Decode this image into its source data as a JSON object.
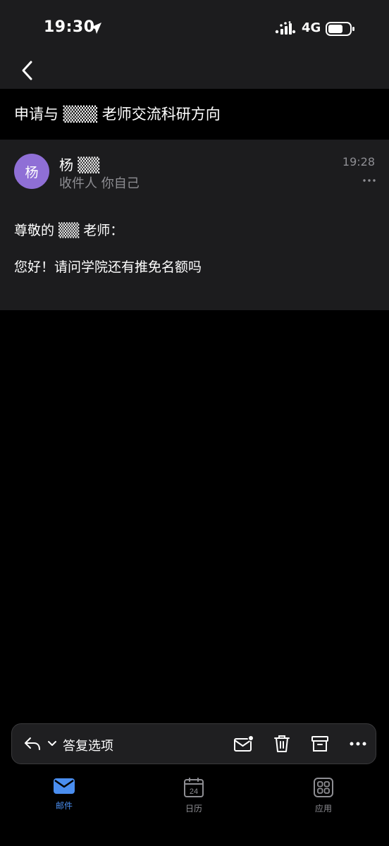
{
  "status_bar": {
    "time": "19:30",
    "network": "4G"
  },
  "email": {
    "subject": "申请与 ▒▒▒ 老师交流科研方向",
    "avatar_initial": "杨",
    "sender": "杨 ▒▒",
    "recipient_line": "收件人 你自己",
    "time": "19:28",
    "greeting": "尊敬的 ▒▒ 老师：",
    "body": "您好！请问学院还有推免名额吗"
  },
  "toolbar": {
    "reply_options_label": "答复选项"
  },
  "tabs": [
    {
      "label": "邮件",
      "active": true
    },
    {
      "label": "日历",
      "active": false,
      "day": "24"
    },
    {
      "label": "应用",
      "active": false
    }
  ],
  "colors": {
    "accent": "#4a8ef0",
    "avatar": "#8f6fd6",
    "card": "#1c1c1e",
    "muted": "#8e8e93"
  }
}
